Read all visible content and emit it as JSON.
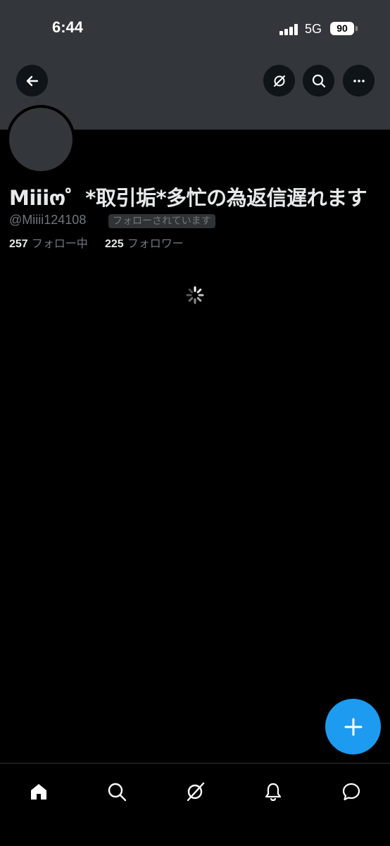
{
  "status_bar": {
    "time": "6:44",
    "network": "5G",
    "battery": "90"
  },
  "header": {
    "back_icon": "arrow-left-icon",
    "actions": [
      {
        "name": "grok-icon"
      },
      {
        "name": "search-icon"
      },
      {
        "name": "more-icon"
      }
    ]
  },
  "profile": {
    "display_name": "Miiiო゜*取引垢*多忙の為返信遅れます",
    "handle": "@Miiii124108",
    "follows_you": "フォローされています",
    "following_count": "257",
    "following_label": "フォロー中",
    "followers_count": "225",
    "followers_label": "フォロワー"
  },
  "content": {
    "loading": true
  },
  "fab": {
    "icon": "plus-icon",
    "color": "#1d9bf0"
  },
  "tabbar": {
    "items": [
      {
        "name": "home-icon"
      },
      {
        "name": "search-icon"
      },
      {
        "name": "grok-icon"
      },
      {
        "name": "bell-icon"
      },
      {
        "name": "message-icon"
      }
    ]
  },
  "colors": {
    "header_bg": "#33363a",
    "background": "#000000",
    "accent": "#1d9bf0",
    "muted_text": "#71767b"
  }
}
